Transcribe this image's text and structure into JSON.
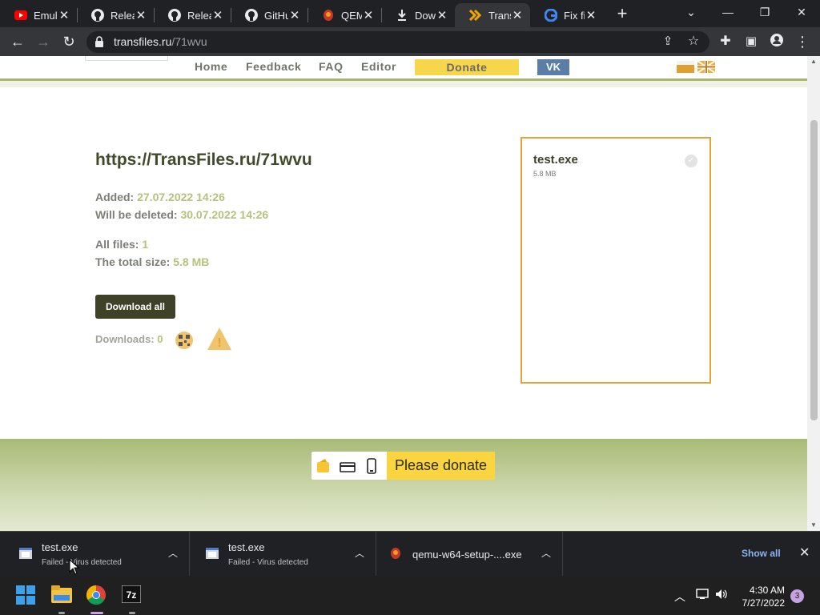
{
  "browser": {
    "tabs": [
      {
        "title": "Emula",
        "icon": "youtube-icon"
      },
      {
        "title": "Relea",
        "icon": "github-icon"
      },
      {
        "title": "Relea",
        "icon": "github-icon"
      },
      {
        "title": "GitHu",
        "icon": "github-icon"
      },
      {
        "title": "QEMU",
        "icon": "qemu-icon"
      },
      {
        "title": "Down",
        "icon": "download-icon"
      },
      {
        "title": "Trans",
        "icon": "transfiles-icon",
        "active": true
      },
      {
        "title": "Fix fil",
        "icon": "google-icon"
      }
    ],
    "new_tab": "+",
    "address": {
      "host": "transfiles.ru",
      "path": "/71wvu"
    }
  },
  "site_nav": {
    "home": "Home",
    "feedback": "Feedback",
    "faq": "FAQ",
    "editor": "Editor",
    "donate": "Donate",
    "vk": "VK"
  },
  "transfer": {
    "link": "https://TransFiles.ru/71wvu",
    "added_label": "Added:",
    "added_value": "27.07.2022 14:26",
    "deleted_label": "Will be deleted:",
    "deleted_value": "30.07.2022 14:26",
    "files_label": "All files:",
    "files_value": "1",
    "size_label": "The total size:",
    "size_value": "5.8 MB",
    "download_all": "Download all",
    "downloads_label": "Downloads:",
    "downloads_value": "0"
  },
  "file_card": {
    "name": "test.exe",
    "size": "5.8 MB"
  },
  "footer": {
    "donate": "Please donate"
  },
  "downloads_shelf": {
    "items": [
      {
        "name": "test.exe",
        "status": "Failed - Virus detected"
      },
      {
        "name": "test.exe",
        "status": "Failed - Virus detected"
      },
      {
        "name": "qemu-w64-setup-....exe",
        "status": ""
      }
    ],
    "show_all": "Show all"
  },
  "taskbar": {
    "time": "4:30 AM",
    "date": "7/27/2022",
    "notifications": "3"
  },
  "colors": {
    "accent_green": "#a7b66b",
    "donate_yellow": "#f6d64a",
    "vk_blue": "#5b7ea8",
    "file_border": "#e0a43a"
  }
}
